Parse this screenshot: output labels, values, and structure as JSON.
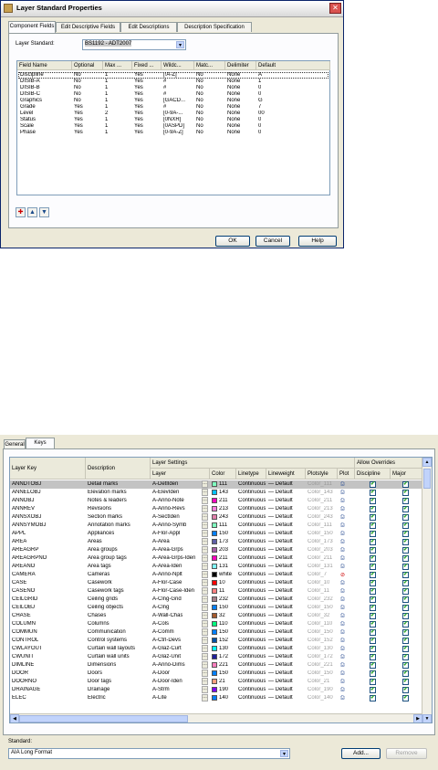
{
  "dialog1": {
    "title": "Layer Standard Properties",
    "close_glyph": "✕",
    "tabs": [
      "Component Fields",
      "Edit Descriptive Fields",
      "Edit Descriptions",
      "Description Specification"
    ],
    "standard_label": "Layer Standard:",
    "standard_value": "BS1192 - ADT2007",
    "columns": [
      "Field Name",
      "Optional",
      "Max ...",
      "Fixed ...",
      "Wildc...",
      "Matc...",
      "Delimiter",
      "Default"
    ],
    "rows": [
      [
        "Discipline",
        "No",
        "1",
        "Yes",
        "[!A-Z]",
        "No",
        "None",
        "A"
      ],
      [
        "DISIB-A",
        "No",
        "1",
        "Yes",
        "#",
        "No",
        "None",
        "1"
      ],
      [
        "DISIB-B",
        "No",
        "1",
        "Yes",
        "#",
        "No",
        "None",
        "0"
      ],
      [
        "DISIB-C",
        "No",
        "1",
        "Yes",
        "#",
        "No",
        "None",
        "0"
      ],
      [
        "Graphics",
        "No",
        "1",
        "Yes",
        "[GACD...",
        "No",
        "None",
        "G"
      ],
      [
        "Grade",
        "Yes",
        "1",
        "Yes",
        "#",
        "No",
        "None",
        "7"
      ],
      [
        "Level",
        "Yes",
        "2",
        "Yes",
        "[0-9A-...",
        "No",
        "None",
        "00"
      ],
      [
        "Status",
        "Yes",
        "1",
        "Yes",
        "[0NXR]",
        "No",
        "None",
        "0"
      ],
      [
        "Scale",
        "Yes",
        "1",
        "Yes",
        "[0ASPD]",
        "No",
        "None",
        "0"
      ],
      [
        "Phase",
        "Yes",
        "1",
        "Yes",
        "[0-9A-Z]",
        "No",
        "None",
        "0"
      ]
    ],
    "toolbar_icons": [
      "pin-icon",
      "move-up-icon",
      "move-down-icon"
    ],
    "buttons": {
      "ok": "OK",
      "cancel": "Cancel",
      "help": "Help"
    }
  },
  "dialog2": {
    "tabs": [
      "General",
      "Keys"
    ],
    "group_headers": {
      "layer_settings": "Layer Settings",
      "allow_overrides": "Allow Overrides"
    },
    "columns": {
      "layer_key": "Layer Key",
      "description": "Description",
      "layer": "Layer",
      "color": "Color",
      "linetype": "Linetype",
      "lineweight": "Lineweight",
      "plotstyle": "Plotstyle",
      "plot": "Plot",
      "discipline": "Discipline",
      "major": "Major"
    },
    "rows": [
      {
        "key": "ANNDTOBJ",
        "desc": "Detail marks",
        "layer": "A-DetlIden",
        "color": "111",
        "hex": "#7fffbf",
        "lt": "Continuous",
        "lw": "— Default",
        "ps": "Color_111",
        "plot": "printer-icon"
      },
      {
        "key": "ANNELOBJ",
        "desc": "Elevation marks",
        "layer": "A-ElevIden",
        "color": "143",
        "hex": "#00bfff",
        "lt": "Continuous",
        "lw": "— Default",
        "ps": "Color_143",
        "plot": "printer-icon"
      },
      {
        "key": "ANNOBJ",
        "desc": "Notes & leaders",
        "layer": "A-Anno-Note",
        "color": "211",
        "hex": "#ff00bf",
        "lt": "Continuous",
        "lw": "— Default",
        "ps": "Color_211",
        "plot": "printer-icon"
      },
      {
        "key": "ANNREV",
        "desc": "Revisions",
        "layer": "A-Anno-Revs",
        "color": "213",
        "hex": "#ff7fdf",
        "lt": "Continuous",
        "lw": "— Default",
        "ps": "Color_213",
        "plot": "printer-icon"
      },
      {
        "key": "ANNSXOBJ",
        "desc": "Section marks",
        "layer": "A-SectIden",
        "color": "243",
        "hex": "#e07faa",
        "lt": "Continuous",
        "lw": "— Default",
        "ps": "Color_243",
        "plot": "printer-icon"
      },
      {
        "key": "ANNSYMOBJ",
        "desc": "Annotation marks",
        "layer": "A-Anno-Symb",
        "color": "111",
        "hex": "#7fffbf",
        "lt": "Continuous",
        "lw": "— Default",
        "ps": "Color_111",
        "plot": "printer-icon"
      },
      {
        "key": "APPL",
        "desc": "Appliances",
        "layer": "A-Flor-Appl",
        "color": "150",
        "hex": "#007fff",
        "lt": "Continuous",
        "lw": "— Default",
        "ps": "Color_150",
        "plot": "printer-icon"
      },
      {
        "key": "AREA",
        "desc": "Areas",
        "layer": "A-Area",
        "color": "173",
        "hex": "#5f5fa5",
        "lt": "Continuous",
        "lw": "— Default",
        "ps": "Color_173",
        "plot": "printer-icon"
      },
      {
        "key": "AREAGRP",
        "desc": "Area groups",
        "layer": "A-Area-Grps",
        "color": "203",
        "hex": "#a55fa5",
        "lt": "Continuous",
        "lw": "— Default",
        "ps": "Color_203",
        "plot": "printer-icon"
      },
      {
        "key": "AREAGRPNO",
        "desc": "Area group tags",
        "layer": "A-Area-Grps-Iden",
        "color": "211",
        "hex": "#ff00bf",
        "lt": "Continuous",
        "lw": "— Default",
        "ps": "Color_211",
        "plot": "printer-icon"
      },
      {
        "key": "AREANO",
        "desc": "Area tags",
        "layer": "A-Area-Iden",
        "color": "131",
        "hex": "#7fffff",
        "lt": "Continuous",
        "lw": "— Default",
        "ps": "Color_131",
        "plot": "printer-icon"
      },
      {
        "key": "CAMERA",
        "desc": "Cameras",
        "layer": "A-Anno-Nplt",
        "color": "white",
        "hex": "#000000",
        "lt": "Continuous",
        "lw": "— Default",
        "ps": "Color_7",
        "plot": "no-plot-icon"
      },
      {
        "key": "CASE",
        "desc": "Casework",
        "layer": "A-Flor-Case",
        "color": "10",
        "hex": "#ff0000",
        "lt": "Continuous",
        "lw": "— Default",
        "ps": "Color_10",
        "plot": "printer-icon"
      },
      {
        "key": "CASENO",
        "desc": "Casework tags",
        "layer": "A-Flor-Case-Iden",
        "color": "11",
        "hex": "#ff7f7f",
        "lt": "Continuous",
        "lw": "— Default",
        "ps": "Color_11",
        "plot": "printer-icon"
      },
      {
        "key": "CEILGRID",
        "desc": "Ceiling grids",
        "layer": "A-Clng-Grid",
        "color": "232",
        "hex": "#a57f8a",
        "lt": "Continuous",
        "lw": "— Default",
        "ps": "Color_232",
        "plot": "printer-icon"
      },
      {
        "key": "CEILOBJ",
        "desc": "Ceiling objects",
        "layer": "A-Clng",
        "color": "150",
        "hex": "#007fff",
        "lt": "Continuous",
        "lw": "— Default",
        "ps": "Color_150",
        "plot": "printer-icon"
      },
      {
        "key": "CHASE",
        "desc": "Chases",
        "layer": "A-Wall-Chas",
        "color": "32",
        "hex": "#a55a2d",
        "lt": "Continuous",
        "lw": "— Default",
        "ps": "Color_32",
        "plot": "printer-icon"
      },
      {
        "key": "COLUMN",
        "desc": "Columns",
        "layer": "A-Cols",
        "color": "110",
        "hex": "#00ff7f",
        "lt": "Continuous",
        "lw": "— Default",
        "ps": "Color_110",
        "plot": "printer-icon"
      },
      {
        "key": "COMMUN",
        "desc": "Communication",
        "layer": "A-Comm",
        "color": "150",
        "hex": "#007fff",
        "lt": "Continuous",
        "lw": "— Default",
        "ps": "Color_150",
        "plot": "printer-icon"
      },
      {
        "key": "CONTROL",
        "desc": "Control systems",
        "layer": "A-Ctrl-Devs",
        "color": "152",
        "hex": "#0051a5",
        "lt": "Continuous",
        "lw": "— Default",
        "ps": "Color_152",
        "plot": "printer-icon"
      },
      {
        "key": "CWLAYOUT",
        "desc": "Curtain wall layouts",
        "layer": "A-Glaz-Curt",
        "color": "130",
        "hex": "#00ffff",
        "lt": "Continuous",
        "lw": "— Default",
        "ps": "Color_130",
        "plot": "printer-icon"
      },
      {
        "key": "CWUNIT",
        "desc": "Curtain wall units",
        "layer": "A-Glaz-Unit",
        "color": "172",
        "hex": "#1f1f99",
        "lt": "Continuous",
        "lw": "— Default",
        "ps": "Color_172",
        "plot": "printer-icon"
      },
      {
        "key": "DIMLINE",
        "desc": "Dimensions",
        "layer": "A-Anno-Dims",
        "color": "221",
        "hex": "#ff7fbf",
        "lt": "Continuous",
        "lw": "— Default",
        "ps": "Color_221",
        "plot": "printer-icon"
      },
      {
        "key": "DOOR",
        "desc": "Doors",
        "layer": "A-Door",
        "color": "150",
        "hex": "#007fff",
        "lt": "Continuous",
        "lw": "— Default",
        "ps": "Color_150",
        "plot": "printer-icon"
      },
      {
        "key": "DOORNO",
        "desc": "Door tags",
        "layer": "A-Door-Iden",
        "color": "21",
        "hex": "#ff9f7f",
        "lt": "Continuous",
        "lw": "— Default",
        "ps": "Color_21",
        "plot": "printer-icon"
      },
      {
        "key": "DRAINAGE",
        "desc": "Drainage",
        "layer": "A-Strm",
        "color": "190",
        "hex": "#7f00ff",
        "lt": "Continuous",
        "lw": "— Default",
        "ps": "Color_190",
        "plot": "printer-icon"
      },
      {
        "key": "ELEC",
        "desc": "Electric",
        "layer": "A-Lite",
        "color": "140",
        "hex": "#007fff",
        "lt": "Continuous",
        "lw": "— Default",
        "ps": "Color_140",
        "plot": "printer-icon"
      }
    ],
    "standard_label": "Standard:",
    "standard_value": "AIA Long Format",
    "buttons": {
      "add": "Add...",
      "remove": "Remove"
    }
  }
}
